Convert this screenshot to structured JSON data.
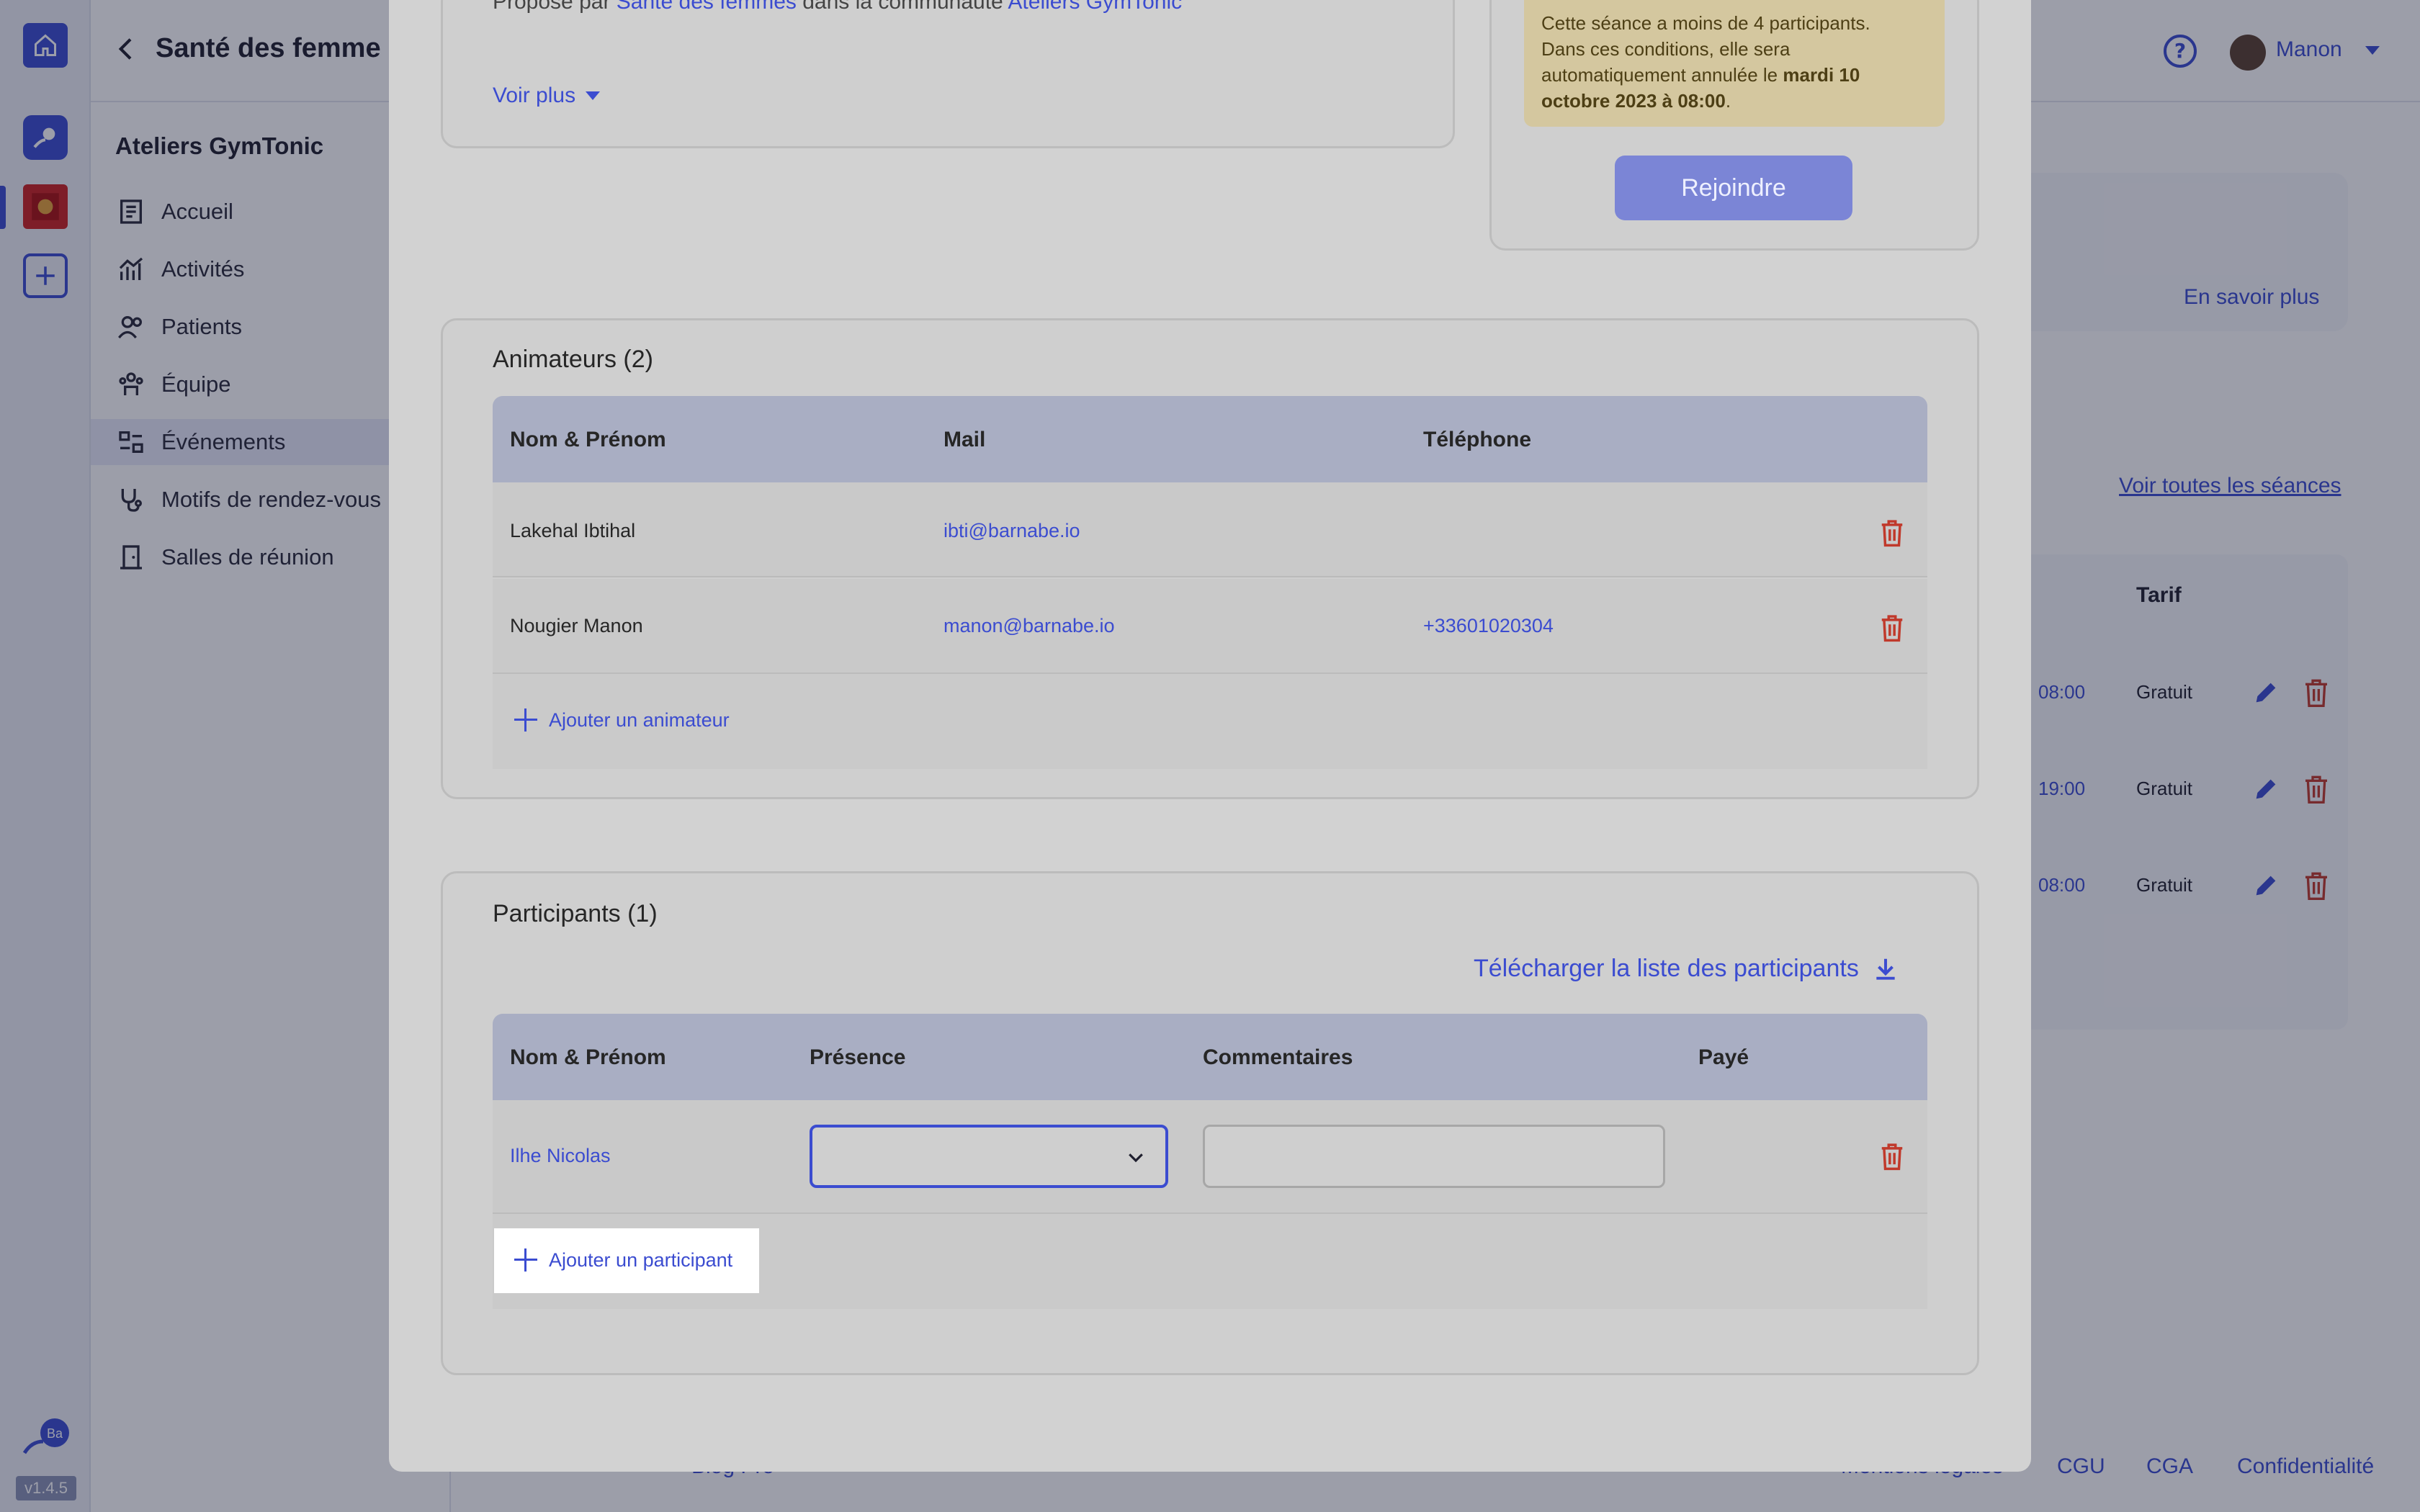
{
  "app": {
    "title": "Santé des femme",
    "version": "v1.4.5",
    "rail_logo_text": "Ba",
    "user_name": "Manon",
    "help_glyph": "?"
  },
  "sidebar": {
    "title": "Ateliers GymTonic",
    "items": [
      {
        "label": "Accueil",
        "icon": "document-icon"
      },
      {
        "label": "Activités",
        "icon": "chart-icon"
      },
      {
        "label": "Patients",
        "icon": "users-icon"
      },
      {
        "label": "Équipe",
        "icon": "team-icon"
      },
      {
        "label": "Événements",
        "icon": "events-icon",
        "active": true
      },
      {
        "label": "Motifs de rendez-vous",
        "icon": "stethoscope-icon"
      },
      {
        "label": "Salles de réunion",
        "icon": "door-icon"
      }
    ]
  },
  "background": {
    "learn_more": "En savoir plus",
    "see_all_sessions": "Voir toutes les séances",
    "tarif_header": "Tarif",
    "sessions": [
      {
        "time": "08:00",
        "price": "Gratuit"
      },
      {
        "time": "19:00",
        "price": "Gratuit"
      },
      {
        "time": "08:00",
        "price": "Gratuit"
      }
    ],
    "footer_links": [
      "Mentions légales",
      "CGU",
      "CGA",
      "Confidentialité"
    ],
    "footer_blog": "Blog Pro"
  },
  "modal": {
    "description": {
      "prefix": "Proposé par ",
      "org": "Santé des femmes",
      "middle": " dans la communauté ",
      "community": "Ateliers GymTonic",
      "see_more": "Voir plus"
    },
    "warning": {
      "line1": "Cette séance a moins de 4 participants.",
      "line2": "Dans ces conditions, elle sera",
      "line3_prefix": "automatiquement annulée le ",
      "line3_bold": "mardi 10",
      "line4_bold": "octobre 2023 à 08:00",
      "line4_suffix": "."
    },
    "join_button": "Rejoindre",
    "animators": {
      "title": "Animateurs (2)",
      "headers": {
        "name": "Nom & Prénom",
        "mail": "Mail",
        "phone": "Téléphone"
      },
      "rows": [
        {
          "name": "Lakehal Ibtihal",
          "mail": "ibti@barnabe.io",
          "phone": ""
        },
        {
          "name": "Nougier Manon",
          "mail": "manon@barnabe.io",
          "phone": "+33601020304"
        }
      ],
      "add_label": "Ajouter un animateur"
    },
    "participants": {
      "title": "Participants (1)",
      "download_label": "Télécharger la liste des participants",
      "headers": {
        "name": "Nom & Prénom",
        "presence": "Présence",
        "comments": "Commentaires",
        "paid": "Payé"
      },
      "rows": [
        {
          "name": "Ilhe Nicolas",
          "presence": "",
          "comment": ""
        }
      ],
      "add_label": "Ajouter un participant"
    }
  },
  "colors": {
    "accent": "#3b4cd0",
    "danger": "#c0392b",
    "warning_bg": "#d4c79f"
  }
}
